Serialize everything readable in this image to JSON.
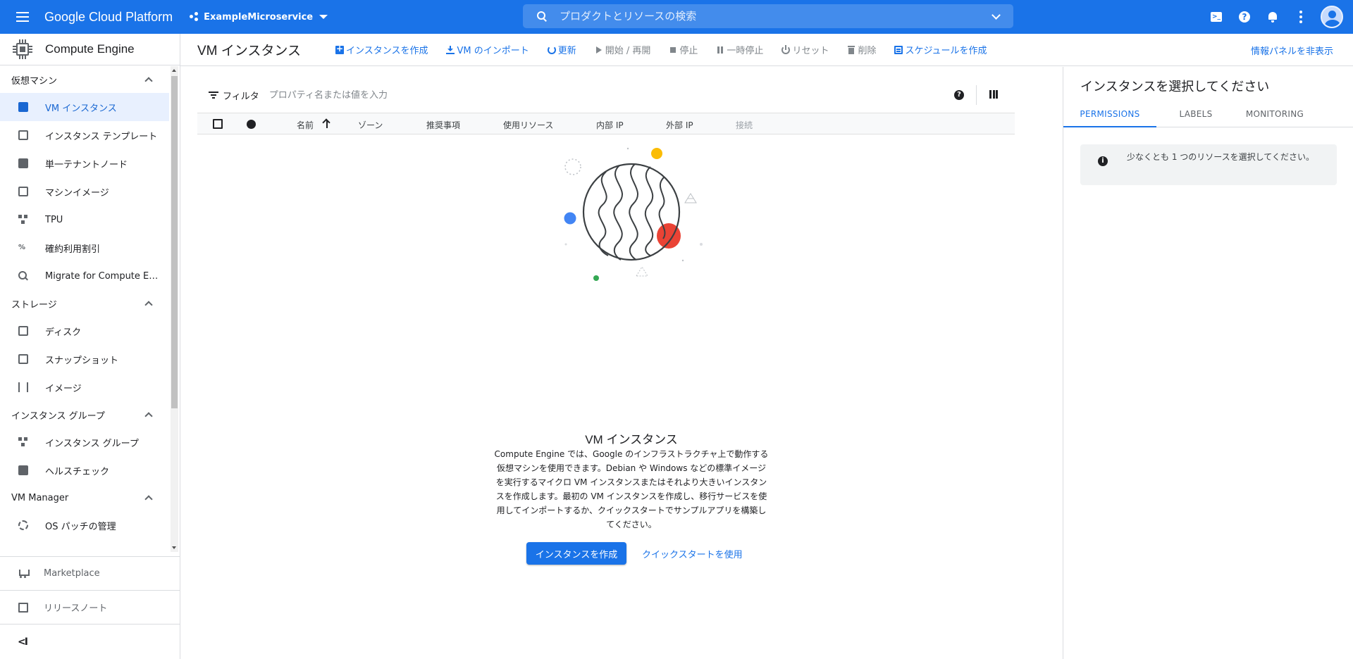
{
  "topbar": {
    "brand": "Google Cloud Platform",
    "project": "ExampleMicroservice",
    "search_placeholder": "プロダクトとリソースの検索"
  },
  "sidebar": {
    "title": "Compute Engine",
    "sections": [
      {
        "label": "仮想マシン",
        "items": [
          {
            "label": "VM インスタンス",
            "icon": "vm-instance-icon",
            "active": true
          },
          {
            "label": "インスタンス テンプレート",
            "icon": "template-icon"
          },
          {
            "label": "単一テナントノード",
            "icon": "sole-tenant-icon"
          },
          {
            "label": "マシンイメージ",
            "icon": "machine-image-icon"
          },
          {
            "label": "TPU",
            "icon": "tpu-icon"
          },
          {
            "label": "確約利用割引",
            "icon": "percent-icon"
          },
          {
            "label": "Migrate for Compute Engine",
            "icon": "search-icon"
          }
        ]
      },
      {
        "label": "ストレージ",
        "items": [
          {
            "label": "ディスク",
            "icon": "disk-icon"
          },
          {
            "label": "スナップショット",
            "icon": "snapshot-icon"
          },
          {
            "label": "イメージ",
            "icon": "image-icon"
          }
        ]
      },
      {
        "label": "インスタンス グループ",
        "items": [
          {
            "label": "インスタンス グループ",
            "icon": "instance-group-icon"
          },
          {
            "label": "ヘルスチェック",
            "icon": "health-check-icon"
          }
        ]
      },
      {
        "label": "VM Manager",
        "items": [
          {
            "label": "OS パッチの管理",
            "icon": "patch-icon"
          }
        ]
      }
    ],
    "marketplace": "Marketplace",
    "release_notes": "リリースノート",
    "collapse": "<I"
  },
  "toolbar": {
    "page_title": "VM インスタンス",
    "create": "インスタンスを作成",
    "import_vm": "VM のインポート",
    "refresh": "更新",
    "start_resume": "開始 / 再開",
    "stop": "停止",
    "suspend": "一時停止",
    "reset": "リセット",
    "delete": "削除",
    "create_schedule": "スケジュールを作成",
    "hide_info_panel": "情報パネルを非表示"
  },
  "filter": {
    "label": "フィルタ",
    "placeholder": "プロパティ名または値を入力"
  },
  "table": {
    "columns": [
      "名前",
      "ゾーン",
      "推奨事項",
      "使用リソース",
      "内部 IP",
      "外部 IP",
      "接続"
    ]
  },
  "empty_state": {
    "title": "VM インスタンス",
    "description": "Compute Engine では、Google のインフラストラクチャ上で動作する仮想マシンを使用できます。Debian や Windows などの標準イメージを実行するマイクロ VM インスタンスまたはそれより大きいインスタンスを作成します。最初の VM インスタンスを作成し、移行サービスを使用してインポートするか、クイックスタートでサンプルアプリを構築してください。",
    "create_button": "インスタンスを作成",
    "quickstart_link": "クイックスタートを使用"
  },
  "info_panel": {
    "title": "インスタンスを選択してください",
    "tabs": [
      "PERMISSIONS",
      "LABELS",
      "MONITORING"
    ],
    "active_tab": "PERMISSIONS",
    "message": "少なくとも 1 つのリソースを選択してください。"
  },
  "colors": {
    "primary": "#1a73e8",
    "active_nav_bg": "#e8f0fe",
    "illustration_yellow": "#fbbc04",
    "illustration_blue": "#4285f4",
    "illustration_red": "#ea4335",
    "illustration_green": "#34a853"
  }
}
